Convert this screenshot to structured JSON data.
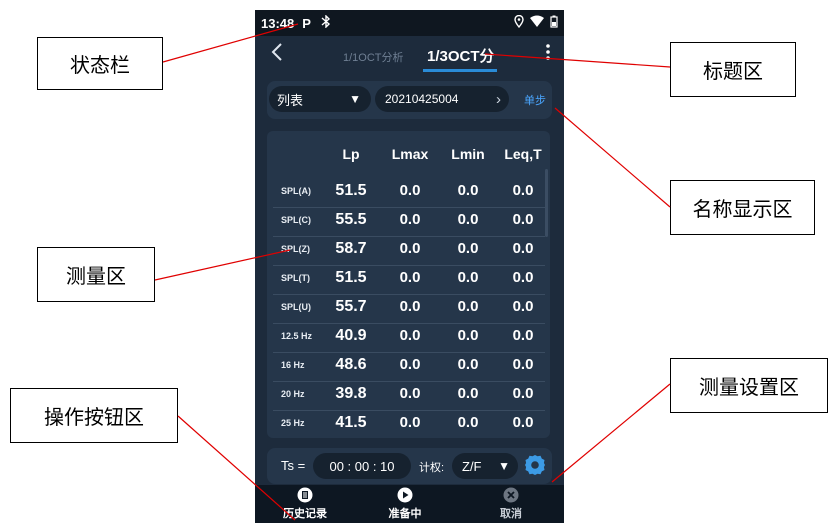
{
  "callouts": {
    "status_bar": "状态栏",
    "title_area": "标题区",
    "name_display_area": "名称显示区",
    "measurement_area": "测量区",
    "action_buttons_area": "操作按钮区",
    "measurement_settings_area": "测量设置区"
  },
  "status": {
    "time": "13:48",
    "icons": [
      "parking-icon",
      "bluetooth-icon",
      "location-icon",
      "wifi-icon",
      "battery-icon"
    ]
  },
  "header": {
    "back_icon": "back-icon",
    "tabs": [
      {
        "label": "1/1OCT分析",
        "active": false
      },
      {
        "label": "1/3OCT分",
        "active": true
      }
    ],
    "more_icon": "more-icon"
  },
  "name_bar": {
    "mode": "列表",
    "file_name": "20210425004",
    "step_label": "单步"
  },
  "table": {
    "headers": [
      "Lp",
      "Lmax",
      "Lmin",
      "Leq,T"
    ],
    "rows": [
      {
        "label": "SPL(A)",
        "values": [
          "51.5",
          "0.0",
          "0.0",
          "0.0"
        ]
      },
      {
        "label": "SPL(C)",
        "values": [
          "55.5",
          "0.0",
          "0.0",
          "0.0"
        ]
      },
      {
        "label": "SPL(Z)",
        "values": [
          "58.7",
          "0.0",
          "0.0",
          "0.0"
        ]
      },
      {
        "label": "SPL(T)",
        "values": [
          "51.5",
          "0.0",
          "0.0",
          "0.0"
        ]
      },
      {
        "label": "SPL(U)",
        "values": [
          "55.7",
          "0.0",
          "0.0",
          "0.0"
        ]
      },
      {
        "label": "12.5 Hz",
        "values": [
          "40.9",
          "0.0",
          "0.0",
          "0.0"
        ]
      },
      {
        "label": "16 Hz",
        "values": [
          "48.6",
          "0.0",
          "0.0",
          "0.0"
        ]
      },
      {
        "label": "20 Hz",
        "values": [
          "39.8",
          "0.0",
          "0.0",
          "0.0"
        ]
      },
      {
        "label": "25 Hz",
        "values": [
          "41.5",
          "0.0",
          "0.0",
          "0.0"
        ]
      }
    ]
  },
  "settings": {
    "ts_label": "Ts =",
    "ts_value": "00 : 00 : 10",
    "weighting_label": "计权:",
    "weighting_value": "Z/F"
  },
  "actions": [
    {
      "label": "历史记录",
      "icon": "history-icon",
      "enabled": true
    },
    {
      "label": "准备中",
      "icon": "play-icon",
      "enabled": true
    },
    {
      "label": "取消",
      "icon": "cancel-icon",
      "enabled": false
    }
  ],
  "colors": {
    "background": "#1d2b3c",
    "panel": "#25364a",
    "accent": "#2a8cd8",
    "status_bar": "#0f1720"
  }
}
